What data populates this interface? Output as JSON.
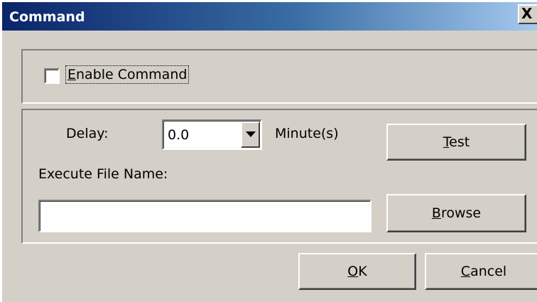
{
  "window": {
    "title": "Command",
    "close_glyph": "X"
  },
  "enable": {
    "checked": false,
    "label_accel": "E",
    "label_rest": "nable Command"
  },
  "settings": {
    "delay_label": "Delay:",
    "delay_value": "0.0",
    "delay_unit": "Minute(s)",
    "file_label": "Execute File Name:",
    "file_value": ""
  },
  "buttons": {
    "test": {
      "accel": "T",
      "rest": "est"
    },
    "browse": {
      "accel": "B",
      "rest": "rowse"
    },
    "ok": {
      "accel": "O",
      "rest": "K"
    },
    "cancel": {
      "accel": "C",
      "rest": "ancel"
    }
  },
  "icons": {
    "close": "close-icon",
    "dropdown": "chevron-down-icon"
  }
}
